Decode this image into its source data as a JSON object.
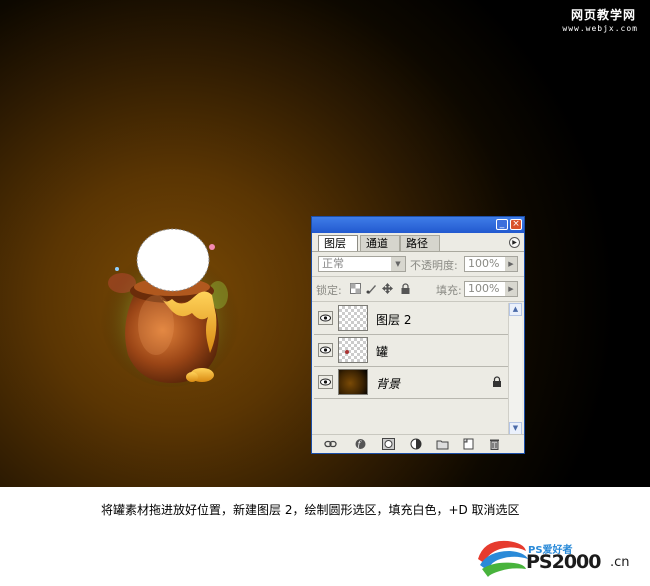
{
  "watermark": {
    "main": "网页教学网",
    "url": "www.webjx.com"
  },
  "panel": {
    "tabs": [
      "图层",
      "通道",
      "路径"
    ],
    "blend_mode": "正常",
    "opacity_label": "不透明度:",
    "opacity_value": "100%",
    "lock_label": "锁定:",
    "fill_label": "填充:",
    "fill_value": "100%",
    "layers": [
      {
        "name": "图层 2"
      },
      {
        "name": "罐"
      },
      {
        "name": "背景"
      }
    ]
  },
  "caption": "将罐素材拖进放好位置，新建图层 2，绘制圆形选区，填充白色，+D 取消选区",
  "logo": {
    "top": "PS爱好者",
    "main": "PS2000",
    "suffix": ".cn"
  },
  "colors": {
    "titlebar": "#2a62d8",
    "panel_bg": "#ecebe4",
    "canvas_glow": "#7a4a05"
  }
}
